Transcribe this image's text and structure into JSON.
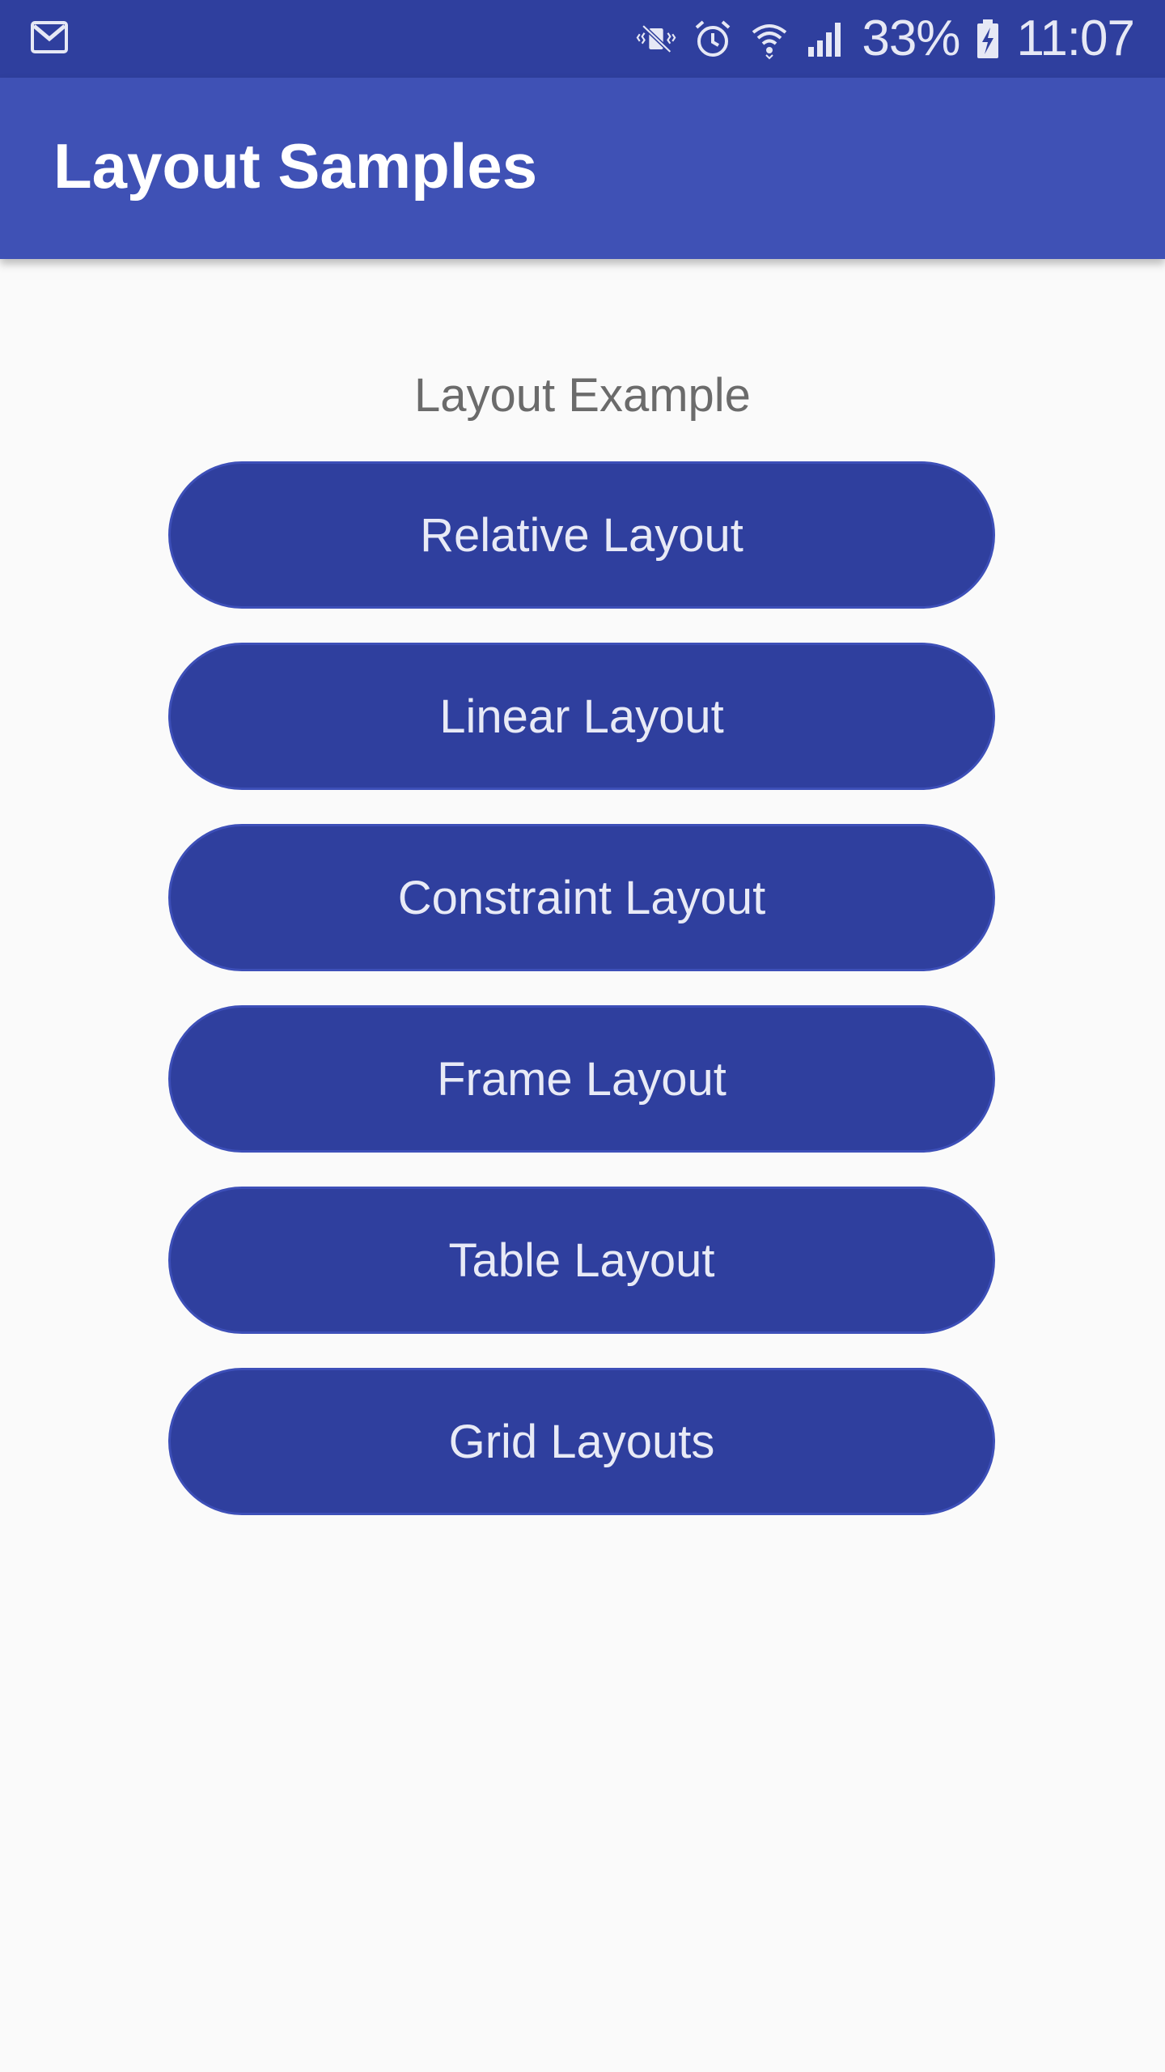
{
  "status_bar": {
    "left_icon": "gmail-icon",
    "icons": [
      "vibrate-mute-icon",
      "alarm-icon",
      "wifi-icon",
      "signal-icon"
    ],
    "battery_percent": "33%",
    "battery_icon": "battery-charging-icon",
    "time": "11:07"
  },
  "app_bar": {
    "title": "Layout Samples"
  },
  "main": {
    "label": "Layout Example",
    "buttons": [
      {
        "label": "Relative Layout"
      },
      {
        "label": "Linear Layout"
      },
      {
        "label": "Constraint Layout"
      },
      {
        "label": "Frame Layout"
      },
      {
        "label": "Table Layout"
      },
      {
        "label": "Grid Layouts"
      }
    ]
  },
  "colors": {
    "status_bar": "#2f3f9e",
    "app_bar": "#3f51b5",
    "button": "#2f3f9e",
    "background": "#fafafa"
  }
}
